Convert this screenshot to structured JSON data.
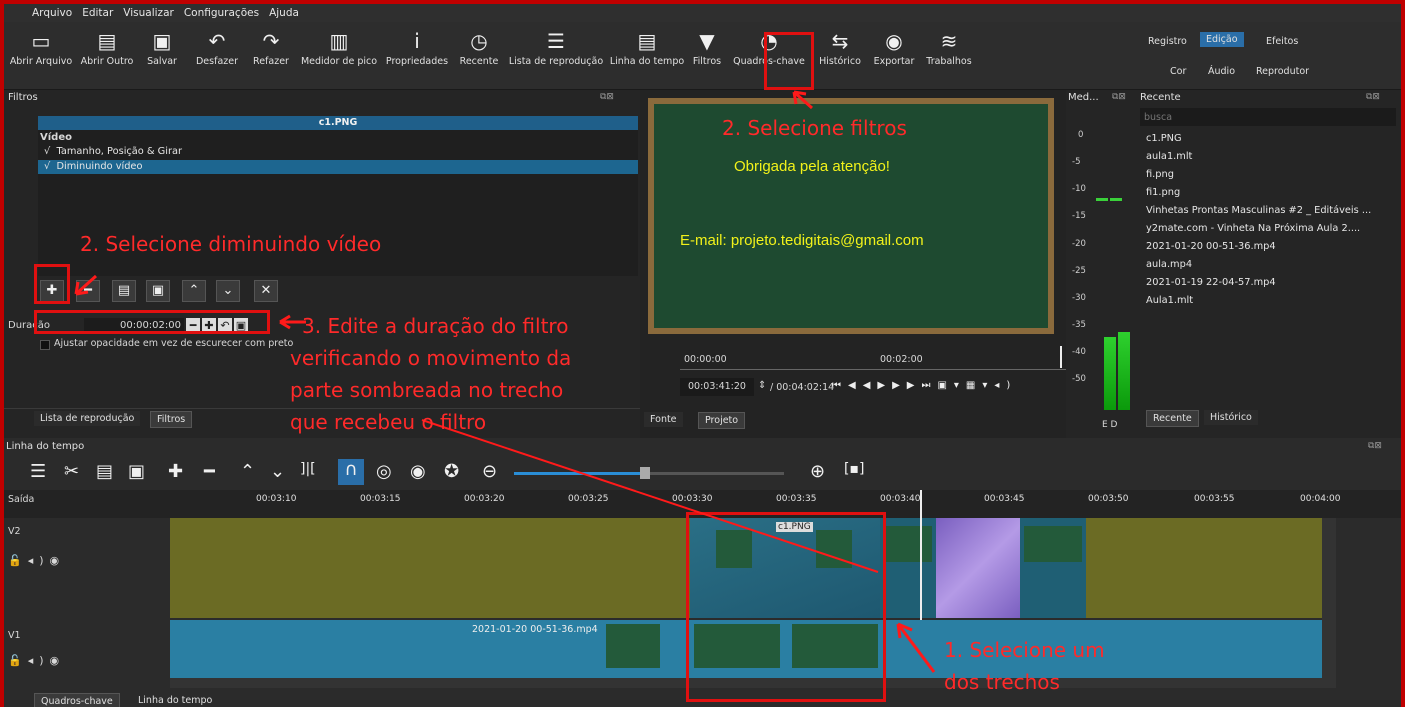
{
  "menu": {
    "items": [
      "Arquivo",
      "Editar",
      "Visualizar",
      "Configurações",
      "Ajuda"
    ]
  },
  "toolbar": {
    "buttons": [
      {
        "label": "Abrir Arquivo",
        "icon": "folder-icon"
      },
      {
        "label": "Abrir Outro",
        "icon": "open-other-icon"
      },
      {
        "label": "Salvar",
        "icon": "save-icon"
      },
      {
        "label": "Desfazer",
        "icon": "undo-icon"
      },
      {
        "label": "Refazer",
        "icon": "redo-icon"
      },
      {
        "label": "Medidor de pico",
        "icon": "peak-meter-icon"
      },
      {
        "label": "Propriedades",
        "icon": "info-icon"
      },
      {
        "label": "Recente",
        "icon": "clock-icon"
      },
      {
        "label": "Lista de reprodução",
        "icon": "list-icon"
      },
      {
        "label": "Linha do tempo",
        "icon": "timeline-icon"
      },
      {
        "label": "Filtros",
        "icon": "filter-icon"
      },
      {
        "label": "Quadros-chave",
        "icon": "stopwatch-icon"
      },
      {
        "label": "Histórico",
        "icon": "history-icon"
      },
      {
        "label": "Exportar",
        "icon": "export-icon"
      },
      {
        "label": "Trabalhos",
        "icon": "jobs-icon"
      }
    ],
    "layout_tabs_top": [
      "Registro",
      "Edição",
      "Efeitos"
    ],
    "layout_tabs_bottom": [
      "Cor",
      "Áudio",
      "Reprodutor"
    ]
  },
  "filters": {
    "title": "Filtros",
    "clip_name": "c1.PNG",
    "category": "Vídeo",
    "items": [
      {
        "label": "Tamanho, Posição & Girar",
        "checked": true,
        "selected": false
      },
      {
        "label": "Diminuindo vídeo",
        "checked": true,
        "selected": true
      }
    ],
    "checkmark": "√",
    "duration_label": "Duração",
    "duration_value": "00:00:02:00",
    "opacity_option": "Ajustar opacidade em vez de escurecer com preto",
    "tabs": [
      "Lista de reprodução",
      "Filtros"
    ]
  },
  "player": {
    "board_text_1": "Obrigada pela atenção!",
    "board_text_2": "E-mail: projeto.tedigitais@gmail.com",
    "ruler_start": "00:00:00",
    "ruler_mid": "00:02:00",
    "position": "00:03:41:20",
    "duration": "/ 00:04:02:14",
    "tabs": [
      "Fonte",
      "Projeto"
    ]
  },
  "meter": {
    "title": "Med...",
    "scale": [
      "0",
      "-5",
      "-10",
      "-15",
      "-20",
      "-25",
      "-30",
      "-35",
      "-40",
      "-50"
    ],
    "channels": "E  D",
    "levels": [
      0.52,
      0.56
    ]
  },
  "recent": {
    "title": "Recente",
    "search_placeholder": "busca",
    "items": [
      "c1.PNG",
      "aula1.mlt",
      "fi.png",
      "fi1.png",
      "Vinhetas Prontas Masculinas #2 _ Editáveis ...",
      "y2mate.com - Vinheta Na Próxima Aula 2....",
      "2021-01-20 00-51-36.mp4",
      "aula.mp4",
      "2021-01-19 22-04-57.mp4",
      "Aula1.mlt"
    ],
    "tabs": [
      "Recente",
      "Histórico"
    ]
  },
  "timeline": {
    "title": "Linha do tempo",
    "output_label": "Saída",
    "ticks": [
      "00:03:10",
      "00:03:15",
      "00:03:20",
      "00:03:25",
      "00:03:30",
      "00:03:35",
      "00:03:40",
      "00:03:45",
      "00:03:50",
      "00:03:55",
      "00:04:00"
    ],
    "tracks": [
      "V2",
      "V1"
    ],
    "clip_v2": "c1.PNG",
    "clip_v1": "2021-01-20 00-51-36.mp4",
    "bottom_tabs": [
      "Quadros-chave",
      "Linha do tempo"
    ]
  },
  "annotations": {
    "a1": "2. Selecione filtros",
    "a2": "2. Selecione diminuindo vídeo",
    "a3": "3. Edite a duração do filtro",
    "a3b": "verificando o movimento da",
    "a3c": "parte sombreada no trecho",
    "a3d": "que recebeu o filtro",
    "a4": "1. Selecione um",
    "a4b": "dos trechos"
  },
  "colors": {
    "accent": "#2a6ea8",
    "annotation": "#ff2a2a",
    "v2_track": "#6b6b24",
    "v1_track": "#2a7fa3",
    "board": "#1e4a30"
  }
}
